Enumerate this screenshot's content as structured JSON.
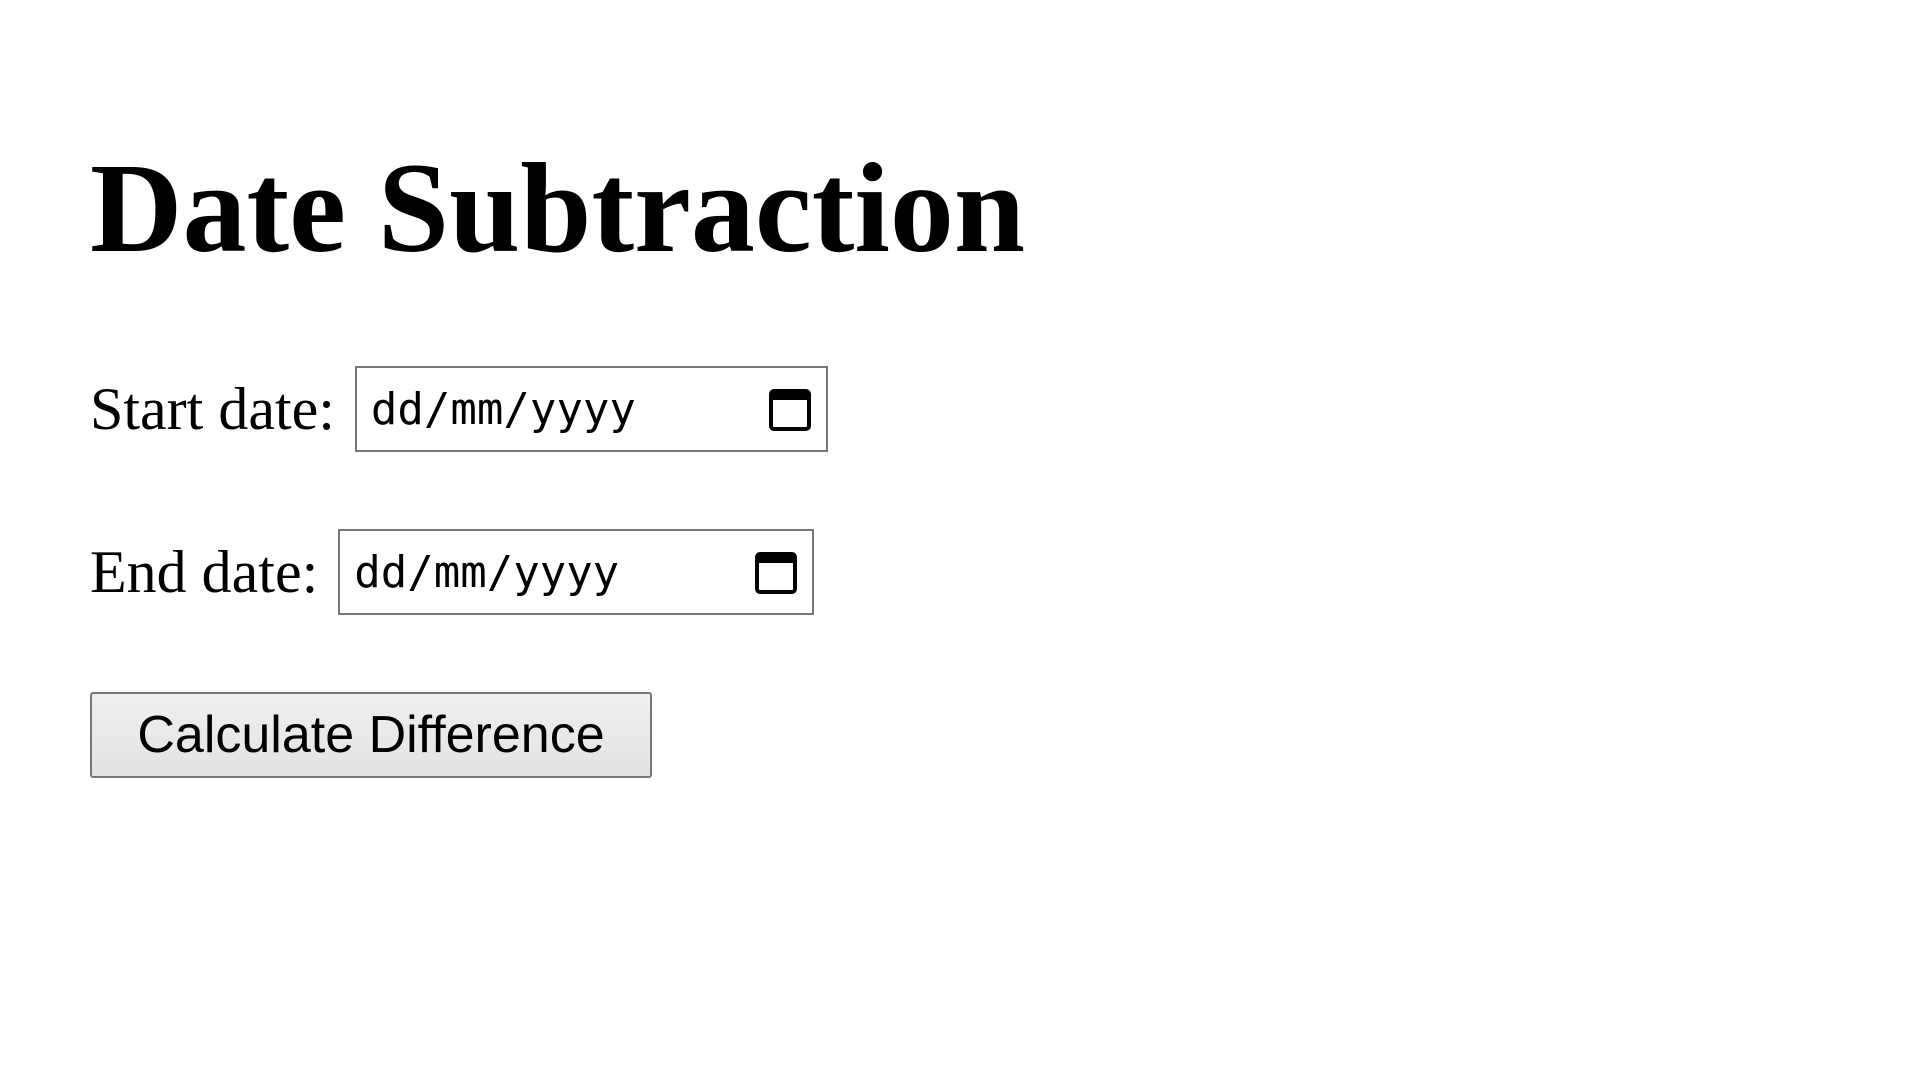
{
  "page": {
    "title": "Date Subtraction"
  },
  "form": {
    "start_label": "Start date:",
    "start_placeholder": "dd/mm/yyyy",
    "end_label": "End date:",
    "end_placeholder": "dd/mm/yyyy",
    "submit_label": "Calculate Difference"
  },
  "icons": {
    "date_picker": "calendar-icon"
  }
}
